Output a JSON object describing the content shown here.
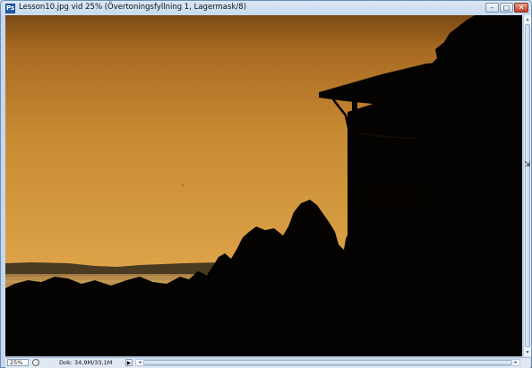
{
  "window": {
    "title": "Lesson10.jpg vid 25% (Övertoningsfyllning 1, Lagermask/8)",
    "app_icon_glyph": "Ps",
    "controls": {
      "minimize_glyph": "–",
      "maximize_glyph": "□",
      "close_glyph": "✕"
    }
  },
  "canvas": {
    "image_subject": "sunset-silhouette-photo",
    "colors": {
      "sky_top": "#7a4a14",
      "sky_bottom": "#e9b358",
      "silhouette": "#050301",
      "water": "#b88a46"
    }
  },
  "statusbar": {
    "zoom": "25%",
    "doc_info": "Dok: 34,9M/33,1M",
    "play_glyph": "▶",
    "scroll_left_glyph": "◂",
    "scroll_right_glyph": "▸"
  },
  "scrollbar": {
    "up_glyph": "▴",
    "down_glyph": "▾"
  },
  "icons": {
    "app": "photoshop-icon",
    "help": "question-icon",
    "cursor": "resize-cursor-icon"
  }
}
